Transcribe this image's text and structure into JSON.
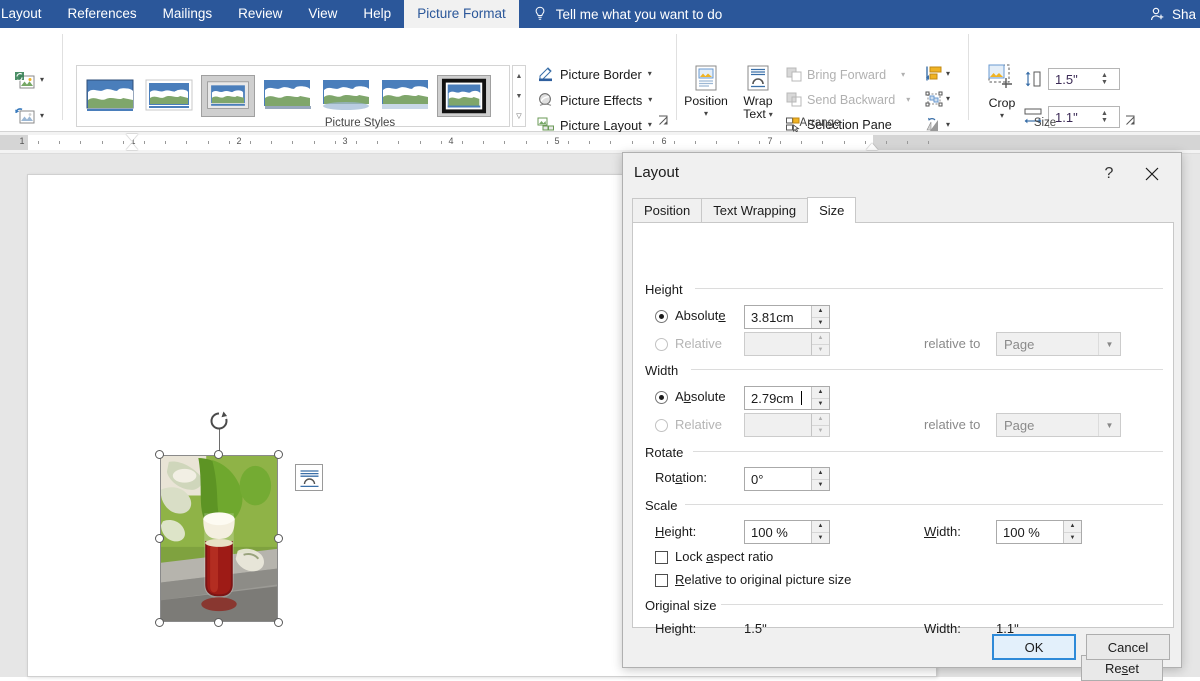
{
  "tabbar": {
    "tabs": [
      {
        "label": "Layout",
        "active": false
      },
      {
        "label": "References",
        "active": false
      },
      {
        "label": "Mailings",
        "active": false
      },
      {
        "label": "Review",
        "active": false
      },
      {
        "label": "View",
        "active": false
      },
      {
        "label": "Help",
        "active": false
      },
      {
        "label": "Picture Format",
        "active": true
      }
    ],
    "tell_me": "Tell me what you want to do",
    "share": "Sha",
    "accent": "#2b579a"
  },
  "ribbon": {
    "groups": {
      "picture_styles": {
        "label": "Picture Styles",
        "selected_index": 6,
        "commands": [
          {
            "label": "Picture Border",
            "icon": "pencil-border-icon"
          },
          {
            "label": "Picture Effects",
            "icon": "effects-icon"
          },
          {
            "label": "Picture Layout",
            "icon": "layout-icon"
          }
        ]
      },
      "arrange": {
        "label": "Arrange",
        "position_label": "Position",
        "wrap_text_label": "Wrap\nText",
        "wrap_text_line1": "Wrap",
        "wrap_text_line2": "Text",
        "commands": [
          {
            "label": "Bring Forward",
            "disabled": true
          },
          {
            "label": "Send Backward",
            "disabled": true
          },
          {
            "label": "Selection Pane",
            "disabled": false
          }
        ]
      },
      "size": {
        "label": "Size",
        "crop_label": "Crop",
        "height_value": "1.5\"",
        "width_value": "1.1\""
      }
    }
  },
  "ruler": {
    "numbers": [
      "1",
      "1",
      "2",
      "3",
      "4",
      "5",
      "6",
      "7"
    ]
  },
  "document": {
    "picture_alt": "glass-of-beer-photo",
    "wrap_badge": "layout-options-icon"
  },
  "dialog": {
    "title": "Layout",
    "help_icon": "?",
    "close_icon": "close-icon",
    "tabs": [
      {
        "label": "Position",
        "active": false
      },
      {
        "label": "Text Wrapping",
        "active": false
      },
      {
        "label": "Size",
        "active": true
      }
    ],
    "height_section": {
      "title": "Height",
      "absolute_label": "Absolute",
      "absolute_value": "3.81cm",
      "absolute_selected": true,
      "relative_label": "Relative",
      "relative_value": "",
      "relative_to_label": "relative to",
      "relative_to_value": "Page"
    },
    "width_section": {
      "title": "Width",
      "absolute_label": "Absolute",
      "absolute_value": "2.79cm",
      "absolute_selected": true,
      "relative_label": "Relative",
      "relative_value": "",
      "relative_to_label": "relative to",
      "relative_to_value": "Page"
    },
    "rotate_section": {
      "title": "Rotate",
      "rotation_label": "Rotation:",
      "rotation_value": "0°"
    },
    "scale_section": {
      "title": "Scale",
      "height_label": "Height:",
      "height_value": "100 %",
      "width_label": "Width:",
      "width_value": "100 %",
      "lock_aspect_label": "Lock aspect ratio",
      "lock_aspect_checked": false,
      "relative_original_label": "Relative to original picture size",
      "relative_original_checked": false
    },
    "original_size_section": {
      "title": "Original size",
      "height_label": "Height:",
      "height_value": "1.5ʺ",
      "width_label": "Width:",
      "width_value": "1.1ʺ"
    },
    "buttons": {
      "reset": "Reset",
      "ok": "OK",
      "cancel": "Cancel"
    }
  }
}
